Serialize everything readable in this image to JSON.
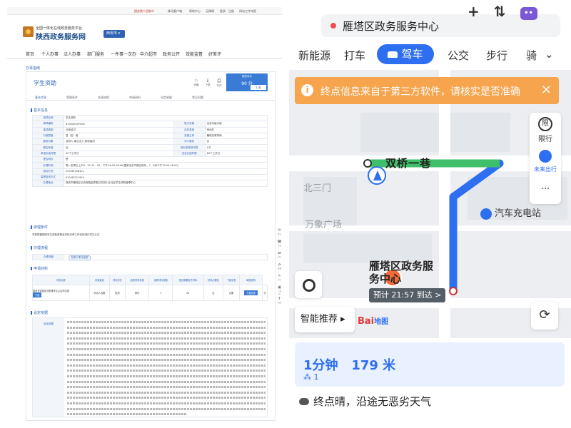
{
  "left": {
    "top_links": [
      "国务院人民群众",
      "移动客户端",
      "帮助中心",
      "无障碍",
      "登录",
      "注册",
      "网站工作年报"
    ],
    "logo_small": "全国一体化在线政务服务平台",
    "logo_big": "陕西政务服务网",
    "region": "西安市",
    "nav": [
      "首页",
      "个人办事",
      "法人办事",
      "部门服务",
      "一件事一次办",
      "中介超市",
      "政务公开",
      "效能监督",
      "好差评"
    ],
    "breadcrumb": "办事指南",
    "service_title": "学生资助",
    "actions": [
      {
        "glyph": "☆",
        "label": "收藏"
      },
      {
        "glyph": "↓",
        "label": "下载"
      },
      {
        "glyph": "⎙",
        "label": "打印"
      }
    ],
    "rating": {
      "label": "服务评价",
      "score": "90 分",
      "btn": "1 条"
    },
    "tabs": [
      "基本信息",
      "受理条件",
      "办理流程",
      "申请材料",
      "设定依据",
      "常见问题"
    ],
    "sections": {
      "basic": "基本信息",
      "cond": "受理条件",
      "proc": "办理流程",
      "mat": "申请材料",
      "basis": "设定依据"
    },
    "info_rows": [
      [
        "事项名称",
        "学生资助",
        "",
        ""
      ],
      [
        "事项编码",
        "610000007000",
        "权力来源",
        "法定本级行使"
      ],
      [
        "事项类型",
        "行政给付",
        "办件类型",
        "承诺件"
      ],
      [
        "行使层级",
        "县（区）级",
        "实施主体",
        "雁塔区教育局"
      ],
      [
        "服务对象",
        "自然人,事业法人,其他组织",
        "中介服务",
        "否"
      ],
      [
        "是否收费",
        "否",
        "到办事现场次数",
        "1次"
      ],
      [
        "承诺办结时限",
        "60个工作日",
        "法定办结时限",
        "60个工作日"
      ],
      [
        "是否网办",
        "是",
        "",
        ""
      ],
      [
        "办理时间",
        "周一至周五上午8：30-12：00，下午14:00-18:00(国家法定节假日除外；7、8月下午15:00-18:00)",
        "",
        ""
      ],
      [
        "咨询方式",
        "029-85258101",
        "",
        ""
      ],
      [
        "监督投诉方式",
        "029-85221929",
        "",
        ""
      ],
      [
        "办理地点",
        "西安市雁塔区长安南路金泰假日花城小区北区学生资助管理中心",
        "",
        ""
      ]
    ],
    "cond_text": "学校根据国家学生资助政策及学校评审工作安排进行学生认定",
    "proc": {
      "label": "办理流程",
      "link": "查看办理流程图"
    },
    "mat_head": [
      "材料名称",
      "来源渠道",
      "材料形式",
      "纸质材料份数",
      "纸质材料规格",
      "是否需要电子材料",
      "材料必要性",
      "下载空表",
      "填报说明"
    ],
    "mat_row": [
      "陕西省家庭经济困难学生认定申请表",
      "申请人自备",
      "纸质",
      "原件",
      "1",
      "A4",
      "否",
      "必要",
      "下载空表",
      "无"
    ],
    "mat_preview": "下载",
    "basis_label": "设定依据",
    "side_tools": [
      {
        "g": "✉",
        "t": "留言"
      },
      {
        "g": "☎",
        "t": "咨询"
      },
      {
        "g": "⇄",
        "t": "对比"
      },
      {
        "g": "⌂",
        "t": "收藏"
      },
      {
        "g": "✎",
        "t": "评价"
      },
      {
        "g": "▣",
        "t": "二维码"
      },
      {
        "g": "⇑",
        "t": "顶部"
      }
    ]
  },
  "right": {
    "destination": "雁塔区政务服务中心",
    "tabs": [
      "新能源",
      "打车",
      "驾车",
      "公交",
      "步行",
      "骑"
    ],
    "active_tab": "驾车",
    "notice": "终点信息来自于第三方软件，请核实是否准确",
    "limit_label": "限行",
    "limit_glyph": "限",
    "future_label": "未来出行",
    "more_glyph": "···",
    "street": "双桥一巷",
    "poi_north3": "北三门",
    "poi_plaza": "万象广场",
    "poi_charge": "汽车充电站",
    "dest_name": "雁塔区政务服务中心",
    "eta": "预计 21:57 到达 >",
    "smart": "智能推荐 ▸",
    "logo": "Bai",
    "logo_tail": "地图",
    "duration": "1分钟",
    "distance": "179 米",
    "lights": " 1",
    "weather": "终点晴，沿途无恶劣天气"
  }
}
